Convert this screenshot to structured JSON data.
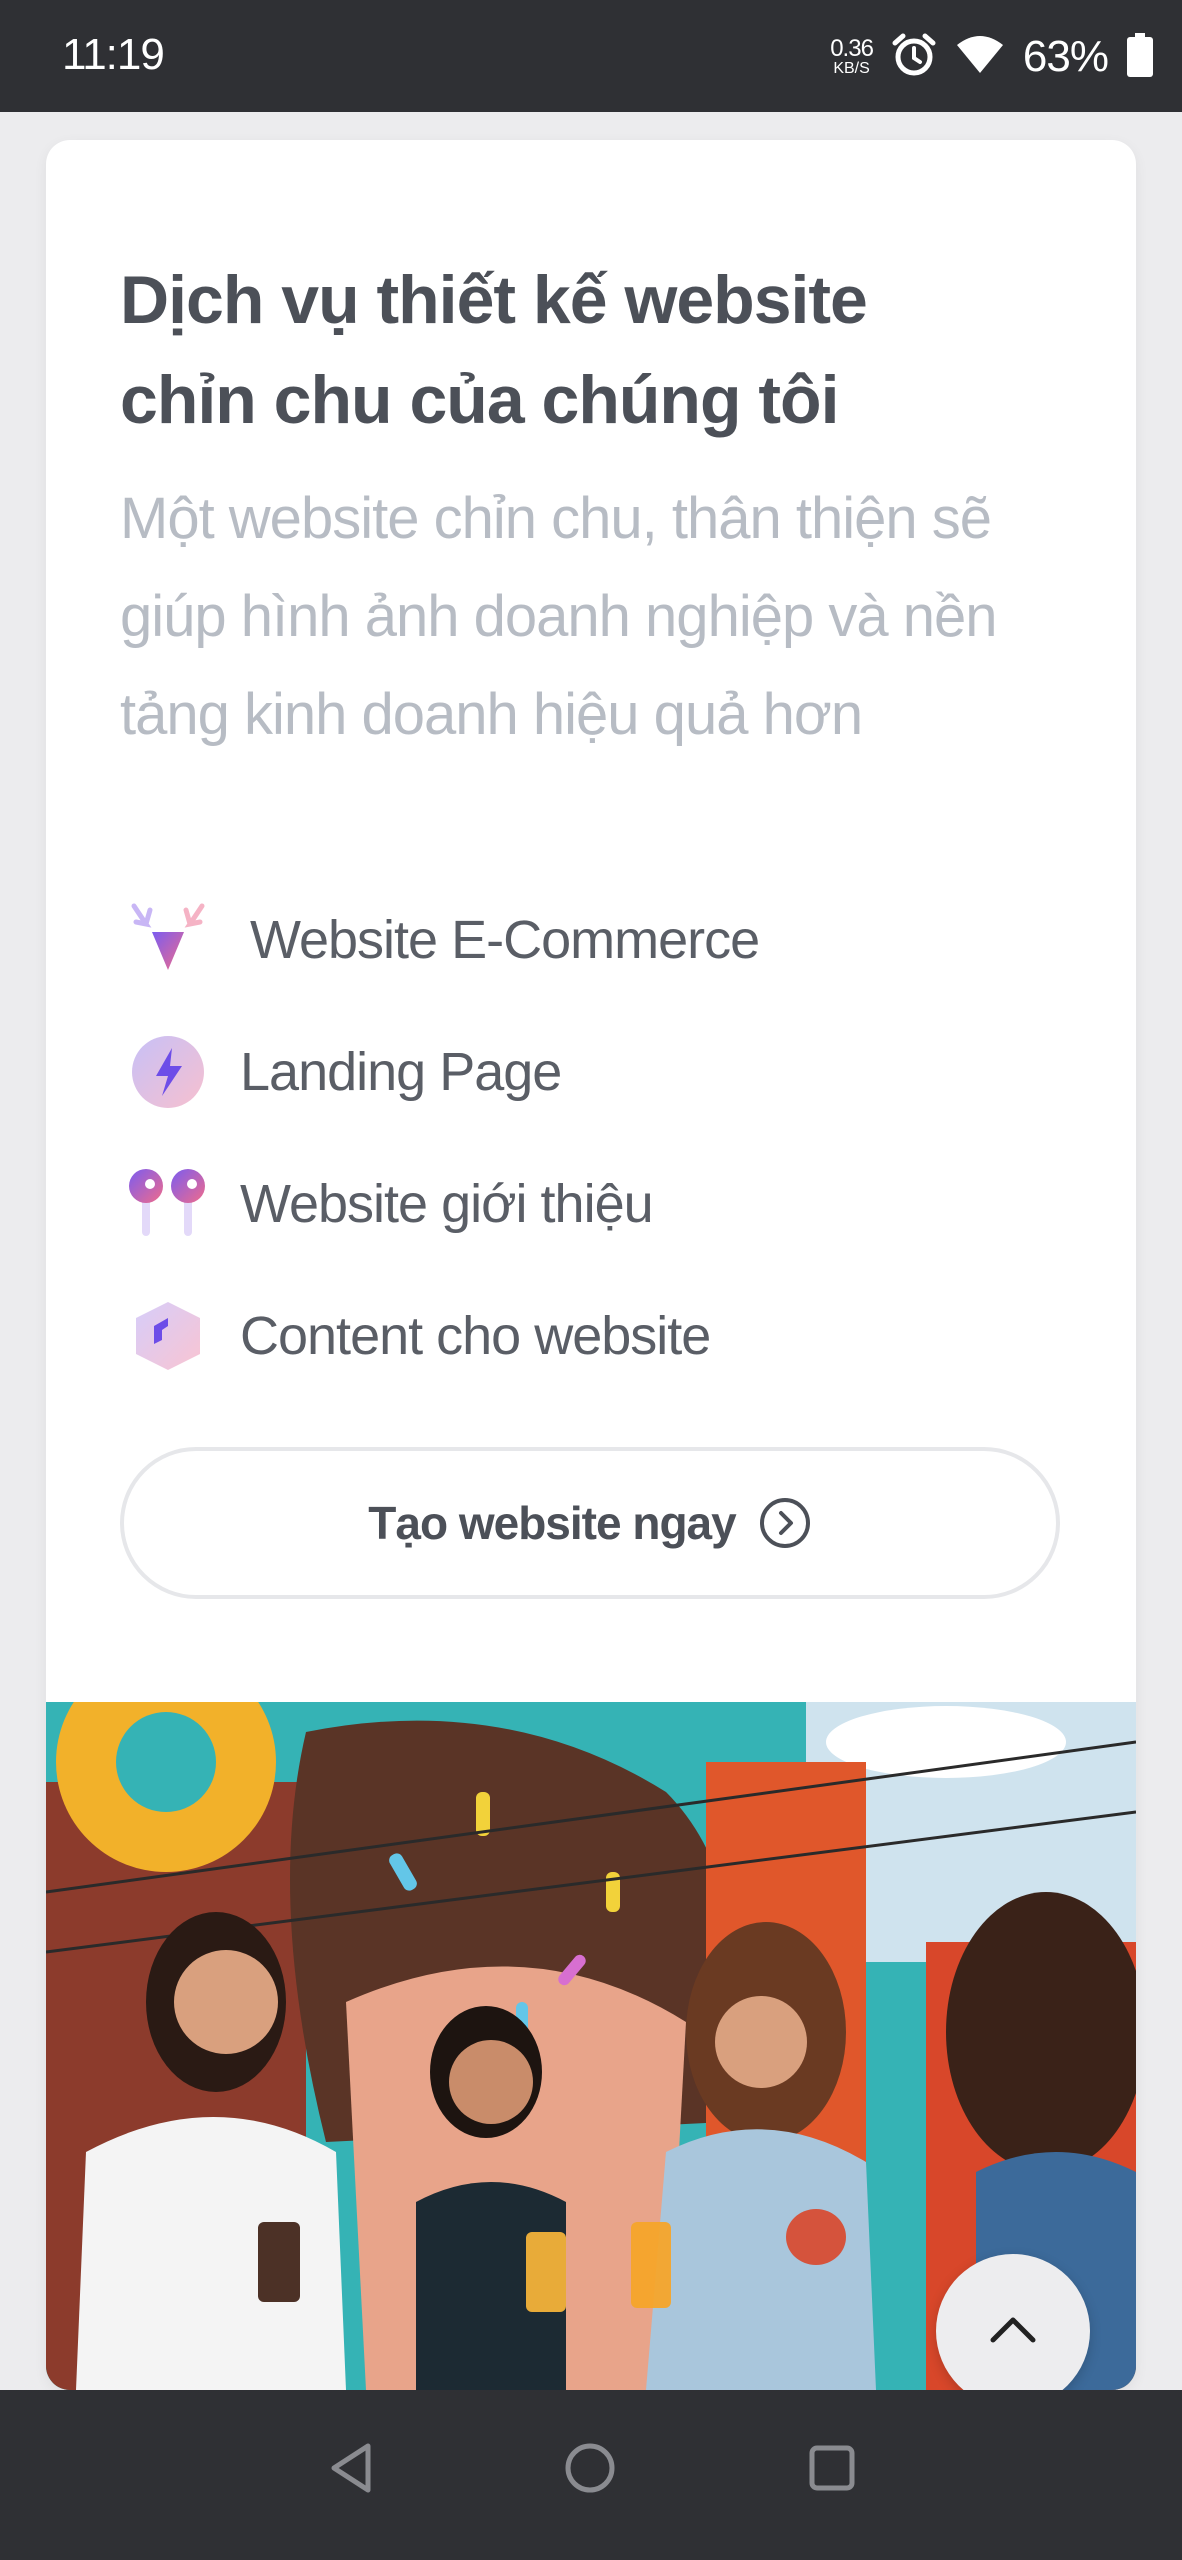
{
  "status_bar": {
    "time": "11:19",
    "net_speed_value": "0.36",
    "net_speed_unit": "KB/S",
    "icons": [
      "alarm-icon",
      "wifi-icon",
      "battery-icon"
    ],
    "battery": "63%"
  },
  "section": {
    "title": "Dịch vụ thiết kế website chỉn chu của chúng tôi",
    "subtitle": "Một website chỉn chu, thân thiện sẽ giúp hình ảnh doanh nghiệp và nền tảng kinh doanh hiệu quả hơn",
    "services": [
      {
        "icon": "antler-icon",
        "label": "Website E-Commerce"
      },
      {
        "icon": "lightning-icon",
        "label": "Landing Page"
      },
      {
        "icon": "earbuds-icon",
        "label": "Website giới thiệu"
      },
      {
        "icon": "cube-icon",
        "label": "Content cho website"
      }
    ],
    "cta_label": "Tạo website ngay",
    "photo_alt": "photo"
  },
  "colors": {
    "accent_purple": "#7b5cf0",
    "accent_pink": "#f06b8b",
    "text_dark": "#4c5058",
    "text_muted": "#b7bcc4"
  },
  "nav_bar": {
    "buttons": [
      "back-icon",
      "home-icon",
      "recents-icon"
    ]
  }
}
